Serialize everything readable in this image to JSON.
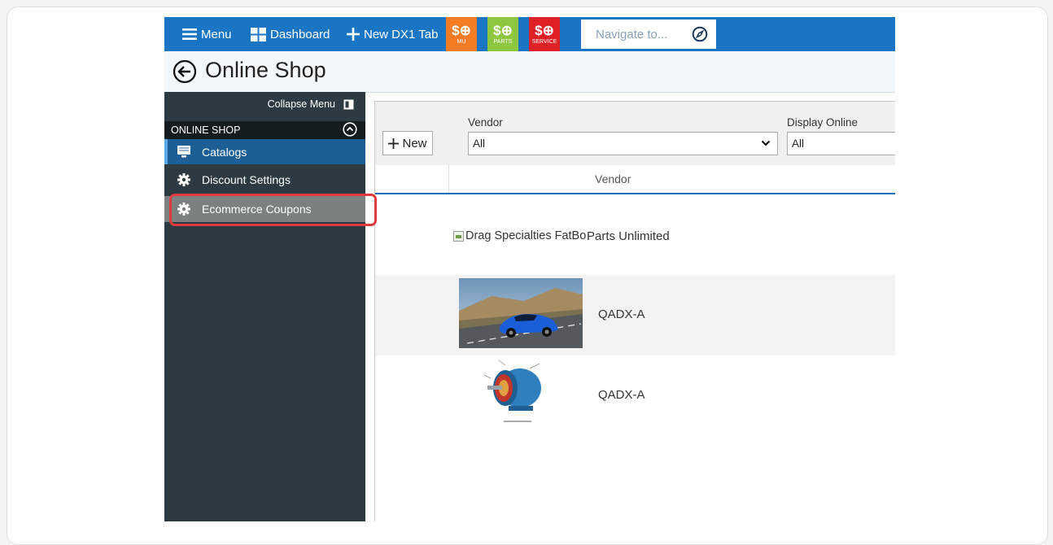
{
  "topbar": {
    "menu_label": "Menu",
    "dashboard_label": "Dashboard",
    "new_tab_label": "New DX1 Tab",
    "tiles": [
      {
        "caption": "MU",
        "color": "#f47c25"
      },
      {
        "caption": "PARTS",
        "color": "#8dc63f"
      },
      {
        "caption": "SERVICE",
        "color": "#e02027"
      }
    ],
    "navigate_placeholder": "Navigate to..."
  },
  "page": {
    "title": "Online Shop"
  },
  "sidebar": {
    "collapse_label": "Collapse Menu",
    "section_label": "ONLINE SHOP",
    "items": [
      {
        "label": "Catalogs",
        "icon": "catalog-icon"
      },
      {
        "label": "Discount Settings",
        "icon": "gear-icon"
      },
      {
        "label": "Ecommerce Coupons",
        "icon": "gear-icon"
      }
    ]
  },
  "filters": {
    "new_label": "New",
    "vendor_label": "Vendor",
    "vendor_value": "All",
    "display_online_label": "Display Online",
    "display_online_value": "All"
  },
  "table": {
    "column_vendor": "Vendor",
    "rows": [
      {
        "image_alt": "Drag Specialties FatBo",
        "vendor": "Parts Unlimited"
      },
      {
        "image": "blue-sports-car",
        "vendor": "QADX-A"
      },
      {
        "image": "electric-motor-diagram",
        "vendor": "QADX-A"
      }
    ]
  },
  "colors": {
    "topbar": "#1a76c5",
    "sidebar": "#2e3a41",
    "active_item": "#1c5f96",
    "highlight_box": "#df3b3b"
  }
}
